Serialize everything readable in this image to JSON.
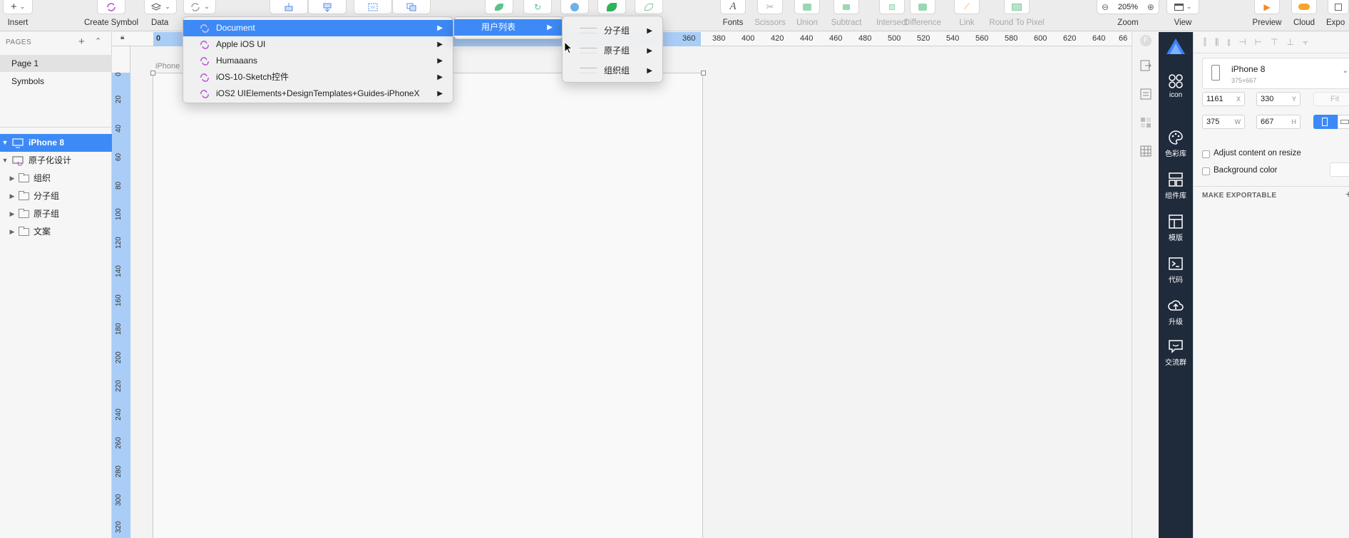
{
  "toolbar": {
    "insert": "Insert",
    "create_symbol": "Create Symbol",
    "data": "Data",
    "fonts": "Fonts",
    "scissors": "Scissors",
    "union": "Union",
    "subtract": "Subtract",
    "intersect": "Intersect",
    "difference": "Difference",
    "link": "Link",
    "round_to_pixel": "Round To Pixel",
    "zoom_value": "205%",
    "zoom": "Zoom",
    "view": "View",
    "preview": "Preview",
    "cloud": "Cloud",
    "export": "Expo"
  },
  "sidebar": {
    "pages_header": "PAGES",
    "pages": [
      "Page 1",
      "Symbols"
    ],
    "layers": [
      {
        "label": "iPhone 8"
      },
      {
        "label": "原子化设计"
      },
      {
        "label": "组织"
      },
      {
        "label": "分子组"
      },
      {
        "label": "原子组"
      },
      {
        "label": "文案"
      }
    ]
  },
  "ruler": {
    "h_start": "0",
    "h_ticks": [
      "0",
      "360",
      "380",
      "400",
      "420",
      "440",
      "460",
      "480",
      "500",
      "520",
      "540",
      "560",
      "580",
      "600",
      "620",
      "640",
      "66"
    ],
    "v_ticks": [
      "0",
      "20",
      "40",
      "60",
      "80",
      "100",
      "120",
      "140",
      "160",
      "180",
      "200",
      "220",
      "240",
      "260",
      "280",
      "300",
      "320"
    ]
  },
  "canvas": {
    "artboard_label": "iPhone"
  },
  "menu_main": [
    {
      "label": "Document"
    },
    {
      "label": "Apple iOS UI"
    },
    {
      "label": "Humaaans"
    },
    {
      "label": "iOS-10-Sketch控件"
    },
    {
      "label": "iOS2 UIElements+DesignTemplates+Guides-iPhoneX"
    }
  ],
  "menu_sub1": [
    {
      "label": "用户列表"
    }
  ],
  "menu_sub2": [
    {
      "label": "分子组"
    },
    {
      "label": "原子组"
    },
    {
      "label": "组织组"
    }
  ],
  "plugin_bar": [
    "icon",
    "色彩库",
    "组件库",
    "模版",
    "代码",
    "升级",
    "交流群"
  ],
  "inspector": {
    "device_name": "iPhone 8",
    "device_size": "375×667",
    "x": "1161",
    "y": "330",
    "w": "375",
    "h": "667",
    "x_label": "X",
    "y_label": "Y",
    "w_label": "W",
    "h_label": "H",
    "fit": "Fit",
    "adjust_content": "Adjust content on resize",
    "background_color": "Background color",
    "make_exportable": "MAKE EXPORTABLE"
  },
  "colors": {
    "accent": "#3d8af7",
    "ruler_highlight": "#a9cdf7",
    "plugin_bar_bg": "#1f2a3b",
    "symbol_icon": "#b84bd1"
  }
}
